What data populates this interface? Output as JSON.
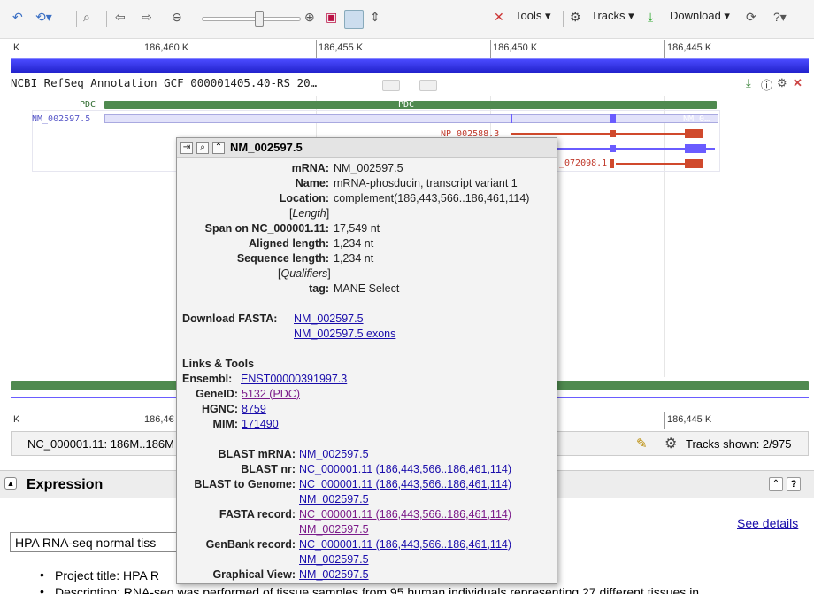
{
  "toolbar": {
    "tools_label": "Tools ▾",
    "tracks_label": "Tracks ▾",
    "download_label": "Download ▾"
  },
  "ruler_top": {
    "labels": [
      "K",
      "186,460 K",
      "186,455 K",
      "186,450 K",
      "186,445 K"
    ]
  },
  "ruler_bottom": {
    "labels": [
      "K",
      "186,4€",
      "186,445 K"
    ]
  },
  "track": {
    "title": "NCBI RefSeq Annotation GCF_000001405.40-RS_20…",
    "gene_left": "PDC",
    "gene_center": "PDC",
    "t1": "NM_002597.5",
    "t1_end": "NM_0…",
    "t2": "NP_002588.3",
    "t3": "_072098.1"
  },
  "bottom_bar": {
    "location": "NC_000001.11: 186M..186M",
    "tracks_shown": "Tracks shown: 2/975"
  },
  "expression": {
    "title": "Expression",
    "see_details": "See details",
    "select_value": "HPA RNA-seq normal tiss",
    "bullet1": "Project title: HPA R",
    "bullet2": "Description: RNA-seq was performed of tissue samples from 95 human individuals representing 27 different tissues in"
  },
  "popup": {
    "title": "NM_002597.5",
    "mrna_k": "mRNA:",
    "mrna_v": "NM_002597.5",
    "name_k": "Name:",
    "name_v": "mRNA-phosducin, transcript variant 1",
    "loc_k": "Location:",
    "loc_v": "complement(186,443,566..186,461,114)",
    "length_open": "[",
    "length_label": "Length",
    "length_close": "]",
    "span_k": "Span on NC_000001.11:",
    "span_v": "17,549 nt",
    "aligned_k": "Aligned length:",
    "aligned_v": "1,234 nt",
    "seq_k": "Sequence length:",
    "seq_v": "1,234 nt",
    "qual_open": "[",
    "qual_label": "Qualifiers",
    "qual_close": "]",
    "tag_k": "tag:",
    "tag_v": "MANE Select",
    "dl_k": "Download FASTA:",
    "dl_1": "NM_002597.5",
    "dl_2": "NM_002597.5 exons",
    "links_h": "Links & Tools",
    "ens_k": "Ensembl:",
    "ens_v": "ENST00000391997.3",
    "gene_k": "GeneID:",
    "gene_v": "5132 (PDC)",
    "hgnc_k": "HGNC:",
    "hgnc_v": "8759",
    "mim_k": "MIM:",
    "mim_v": "171490",
    "bm_k": "BLAST mRNA:",
    "bm_v": "NM_002597.5",
    "bn_k": "BLAST nr:",
    "bn_v": "NC_000001.11 (186,443,566..186,461,114)",
    "bg_k": "BLAST to Genome:",
    "bg_v1": "NC_000001.11 (186,443,566..186,461,114)",
    "bg_v2": "NM_002597.5",
    "fr_k": "FASTA record:",
    "fr_v1": "NC_000001.11 (186,443,566..186,461,114)",
    "fr_v2": "NM_002597.5",
    "gb_k": "GenBank record:",
    "gb_v1": "NC_000001.11 (186,443,566..186,461,114)",
    "gb_v2": "NM_002597.5",
    "gv_k": "Graphical View:",
    "gv_v": "NM_002597.5"
  },
  "colors": {
    "gene": "#4f8a4f",
    "red": "#d0492c",
    "purple": "#6a5cff",
    "blue": "#2a2ad8",
    "link": "#1a0dab",
    "visited": "#7a1a8a"
  }
}
